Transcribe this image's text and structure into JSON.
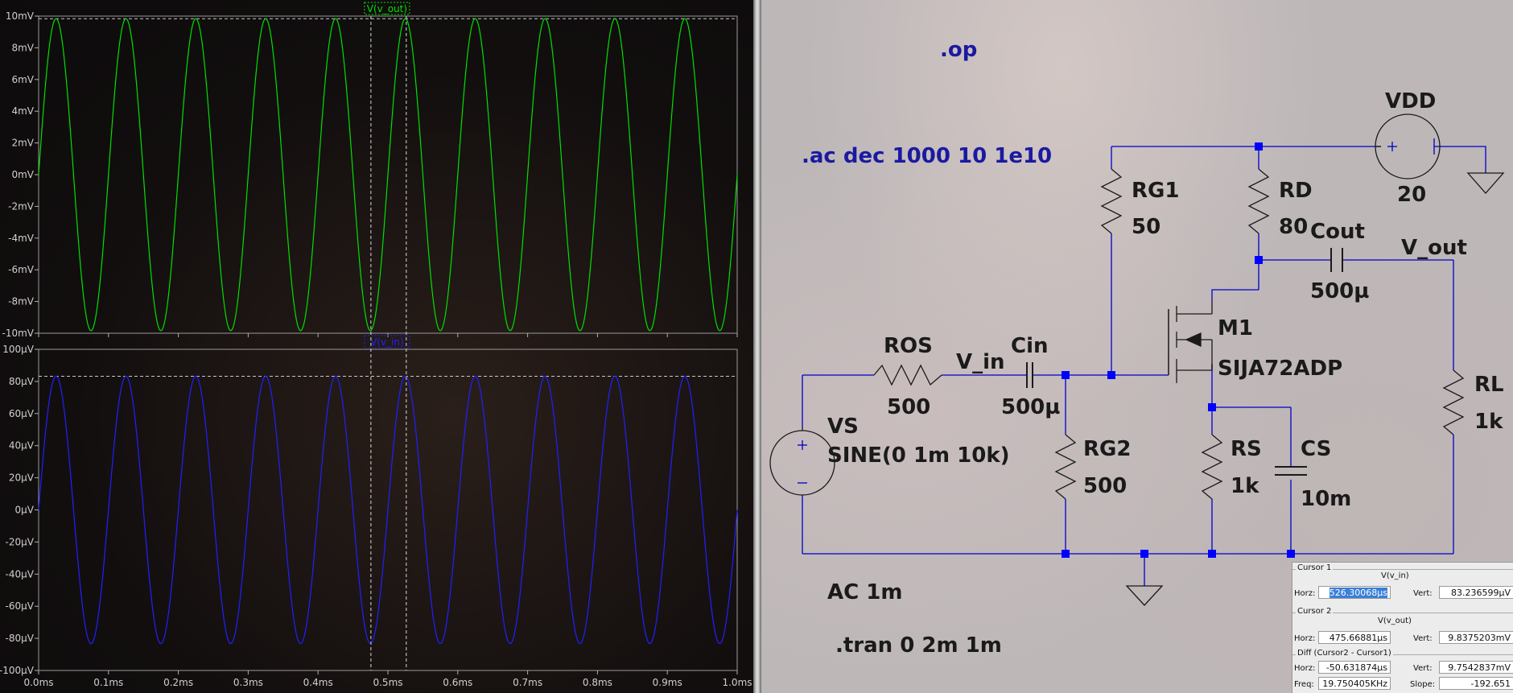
{
  "waveforms": {
    "top": {
      "trace_label": "V(v_out)",
      "trace_color": "#00e000",
      "y_ticks": [
        "10mV",
        "8mV",
        "6mV",
        "4mV",
        "2mV",
        "0mV",
        "-2mV",
        "-4mV",
        "-6mV",
        "-8mV",
        "-10mV"
      ],
      "amplitude": 9.84,
      "ylim": [
        -10,
        10
      ],
      "cursor_y": 9.8375
    },
    "bottom": {
      "trace_label": "V(v_in)",
      "trace_color": "#2020ff",
      "y_ticks": [
        "100µV",
        "80µV",
        "60µV",
        "40µV",
        "20µV",
        "0µV",
        "-20µV",
        "-40µV",
        "-60µV",
        "-80µV",
        "-100µV"
      ],
      "amplitude": 83.24,
      "ylim": [
        -100,
        100
      ],
      "cursor_y": 83.236599
    },
    "x_ticks": [
      "0.0ms",
      "0.1ms",
      "0.2ms",
      "0.3ms",
      "0.4ms",
      "0.5ms",
      "0.6ms",
      "0.7ms",
      "0.8ms",
      "0.9ms",
      "1.0ms"
    ],
    "xlim_ms": [
      0,
      1.0
    ],
    "frequency_khz": 10,
    "cursor1_ms": 0.52630068,
    "cursor2_ms": 0.47566881,
    "grid_color": "#808080",
    "axis_text_color": "#d0d0d0"
  },
  "schematic": {
    "directive_op": ".op",
    "directive_ac": ".ac dec 1000 10 1e10",
    "directive_ac_source": "AC 1m",
    "directive_tran": ".tran 0 2m 1m",
    "wire_color": "#0000c8",
    "text_color": "#1a1a1a",
    "directive_color": "#1a1aa0",
    "components": {
      "vdd_name": "VDD",
      "vdd_value": "20",
      "rg1_name": "RG1",
      "rg1_value": "50",
      "rd_name": "RD",
      "rd_value": "80",
      "cout_name": "Cout",
      "cout_value": "500µ",
      "vout_label": "V_out",
      "m1_name": "M1",
      "m1_value": "SIJA72ADP",
      "ros_name": "ROS",
      "ros_value": "500",
      "vin_label": "V_in",
      "cin_name": "Cin",
      "cin_value": "500µ",
      "rl_name": "RL",
      "rl_value": "1k",
      "vs_name": "VS",
      "vs_value": "SINE(0 1m 10k)",
      "rg2_name": "RG2",
      "rg2_value": "500",
      "rs_name": "RS",
      "rs_value": "1k",
      "cs_name": "CS",
      "cs_value": "10m"
    }
  },
  "cursor_panel": {
    "cursor1": {
      "title": "Cursor 1",
      "trace": "V(v_in)",
      "horz_label": "Horz:",
      "horz_value": "526.30068µs",
      "vert_label": "Vert:",
      "vert_value": "83.236599µV"
    },
    "cursor2": {
      "title": "Cursor 2",
      "trace": "V(v_out)",
      "horz_label": "Horz:",
      "horz_value": "475.66881µs",
      "vert_label": "Vert:",
      "vert_value": "9.8375203mV"
    },
    "diff": {
      "title": "Diff (Cursor2 - Cursor1)",
      "horz_label": "Horz:",
      "horz_value": "-50.631874µs",
      "vert_label": "Vert:",
      "vert_value": "9.7542837mV",
      "freq_label": "Freq:",
      "freq_value": "19.750405KHz",
      "slope_label": "Slope:",
      "slope_value": "-192.651"
    }
  }
}
